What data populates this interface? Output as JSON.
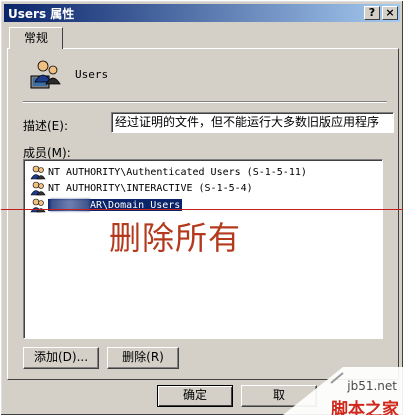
{
  "window": {
    "title": "Users 属性",
    "help_button": "?",
    "close_button": "×"
  },
  "tabs": [
    {
      "label": "常规"
    }
  ],
  "general": {
    "group_name": "Users",
    "description_label": "描述(E):",
    "description_value": "经过证明的文件，但不能运行大多数旧版应用程序",
    "members_label": "成员(M):"
  },
  "members": [
    {
      "icon": "group-icon",
      "text": "NT AUTHORITY\\Authenticated Users (S-1-5-11)"
    },
    {
      "icon": "group-icon",
      "text": "NT AUTHORITY\\INTERACTIVE (S-1-5-4)"
    },
    {
      "icon": "group-icon",
      "text": "AR\\Domain Users",
      "selected": true
    }
  ],
  "overlay": {
    "annotation": "删除所有"
  },
  "buttons": {
    "add": "添加(D)...",
    "remove": "删除(R)",
    "ok": "确定",
    "cancel": "取"
  },
  "watermark": {
    "url": "jb51.net",
    "name": "脚本之家"
  },
  "colors": {
    "titlebar_start": "#0a246a",
    "titlebar_end": "#a6caf0",
    "selection": "#0a246a",
    "annotation": "#b43a1e",
    "watermark": "#d0281c"
  }
}
